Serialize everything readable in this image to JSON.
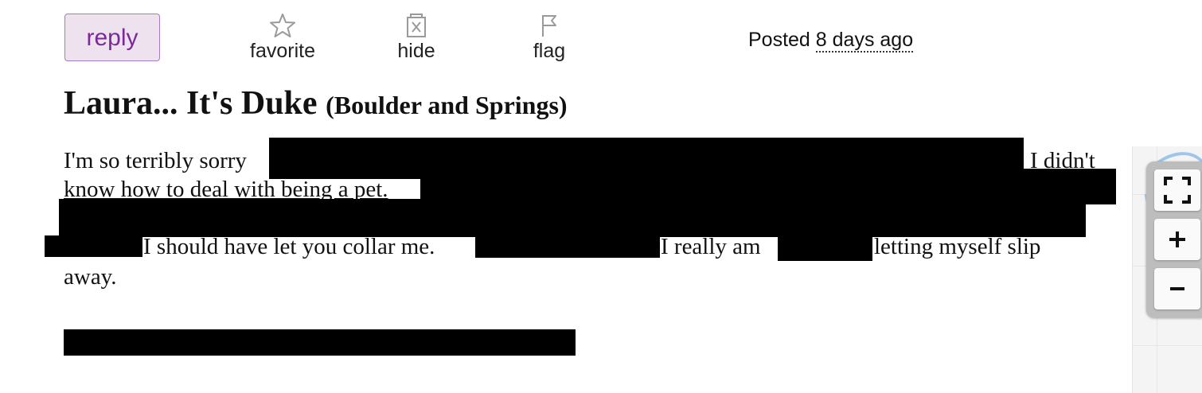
{
  "actions": {
    "reply_label": "reply",
    "favorite_label": "favorite",
    "hide_label": "hide",
    "flag_label": "flag"
  },
  "posted": {
    "prefix": "Posted",
    "relative_time": "8 days ago"
  },
  "post": {
    "title": "Laura... It's Duke",
    "location": "(Boulder and Springs)",
    "line1_start": "I'm so terribly sorry",
    "line1_end": "I didn't",
    "line2": "know how to deal with being a pet.",
    "line4_a": "I should have let you collar me.",
    "line4_b": "I really am",
    "line4_c": "letting myself slip",
    "line5": "away."
  },
  "colors": {
    "reply_bg": "#eee2ef",
    "reply_border": "#a77bc6",
    "reply_text": "#7b2a9a",
    "redaction": "#000000"
  },
  "icons": {
    "favorite": "star-icon",
    "hide": "hide-x-icon",
    "flag": "flag-icon",
    "fullscreen": "fullscreen-icon",
    "zoom_in": "plus-icon",
    "zoom_out": "minus-icon"
  }
}
